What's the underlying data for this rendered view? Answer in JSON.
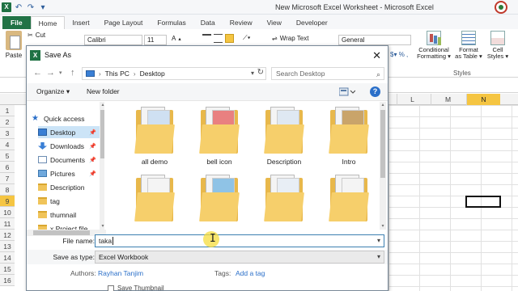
{
  "excel": {
    "title": "New Microsoft Excel Worksheet - Microsoft Excel",
    "tabs": [
      "File",
      "Home",
      "Insert",
      "Page Layout",
      "Formulas",
      "Data",
      "Review",
      "View",
      "Developer"
    ],
    "paste_label": "Paste",
    "cut_label": "Cut",
    "font_name": "Calibri",
    "font_size": "11",
    "wrap_text": "Wrap Text",
    "number_format": "General",
    "styles": {
      "conditional": [
        "Conditional",
        "Formatting ▾"
      ],
      "format_table": [
        "Format",
        "as Table ▾"
      ],
      "cell_styles": [
        "Cell",
        "Styles ▾"
      ],
      "group_label": "Styles"
    },
    "columns": [
      "L",
      "M",
      "N"
    ],
    "rows": [
      "1",
      "2",
      "3",
      "4",
      "5",
      "6",
      "7",
      "8",
      "9",
      "10",
      "11",
      "12",
      "13",
      "14",
      "15",
      "16"
    ]
  },
  "dialog": {
    "title": "Save As",
    "address": {
      "this_pc": "This PC",
      "desktop": "Desktop"
    },
    "search_placeholder": "Search Desktop",
    "toolbar": {
      "organize": "Organize ▾",
      "new_folder": "New folder"
    },
    "nav_items": [
      {
        "label": "Quick access",
        "icon": "star-icon"
      },
      {
        "label": "Desktop",
        "icon": "desktop-icon"
      },
      {
        "label": "Downloads",
        "icon": "download-icon"
      },
      {
        "label": "Documents",
        "icon": "documents-icon"
      },
      {
        "label": "Pictures",
        "icon": "pictures-icon"
      },
      {
        "label": "Description",
        "icon": "folder-icon"
      },
      {
        "label": "tag",
        "icon": "folder-icon"
      },
      {
        "label": "thumnail",
        "icon": "folder-icon"
      },
      {
        "label": "x Project file",
        "icon": "folder-icon"
      }
    ],
    "files": [
      {
        "label": "all demo"
      },
      {
        "label": "bell icon"
      },
      {
        "label": "Description"
      },
      {
        "label": "Intro"
      },
      {
        "label": ""
      },
      {
        "label": ""
      },
      {
        "label": ""
      },
      {
        "label": ""
      }
    ],
    "file_name_label": "File name:",
    "file_name_value": "taka",
    "save_type_label": "Save as type:",
    "save_type_value": "Excel Workbook",
    "authors_label": "Authors:",
    "authors_value": "Rayhan Tanjim",
    "tags_label": "Tags:",
    "tags_value": "Add a tag",
    "thumbnail_label": "Save Thumbnail"
  },
  "colors": {
    "excel_green": "#217346",
    "accent_blue": "#2a6fc9",
    "selection_yellow": "#f5c542"
  }
}
